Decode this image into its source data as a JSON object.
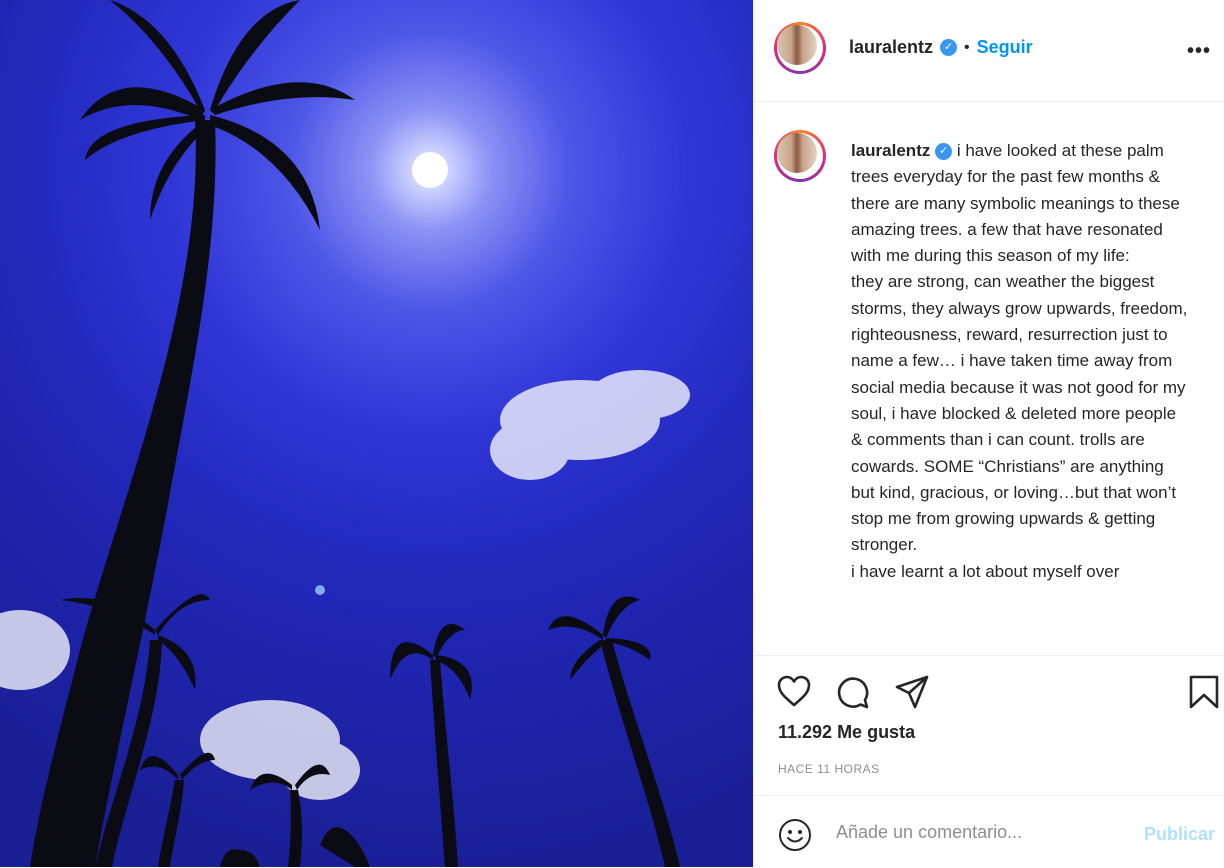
{
  "post": {
    "username": "lauralentz",
    "follow_label": "Seguir",
    "separator": "•",
    "verified_glyph": "✓",
    "more_label": "•••",
    "caption": "i have looked at these palm trees everyday for the past few months & there are many symbolic meanings to these amazing trees. a few that have resonated with me during this season of my life:\nthey are strong, can weather the biggest storms, they always grow upwards, freedom, righteousness, reward, resurrection just to name a few… i have taken time away from social media because it was not good for my soul, i have blocked & deleted more people & comments than i can count. trolls are cowards. SOME “Christians” are anything but kind, gracious, or loving…but that won’t stop me from growing upwards & getting stronger.\ni have learnt a lot about myself over",
    "likes": "11.292 Me gusta",
    "timestamp": "HACE 11 HORAS"
  },
  "comment_box": {
    "placeholder": "Añade un comentario...",
    "publish_label": "Publicar"
  },
  "icons": {
    "like": "heart-icon",
    "comment": "comment-icon",
    "share": "paper-plane-icon",
    "save": "bookmark-icon",
    "emoji": "smiley-icon",
    "verified": "verified-badge-icon"
  },
  "colors": {
    "link_blue": "#0095f6",
    "verified_blue": "#3897f0",
    "muted": "#8e8e8e",
    "publish_disabled": "#b2dffc"
  }
}
